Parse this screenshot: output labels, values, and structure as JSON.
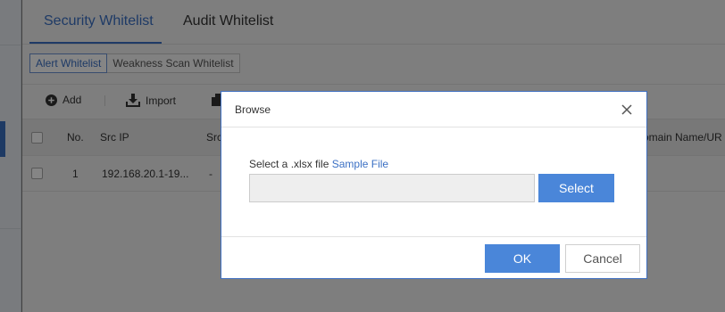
{
  "tabs": [
    {
      "label": "Security Whitelist",
      "active": true
    },
    {
      "label": "Audit Whitelist",
      "active": false
    }
  ],
  "subtabs": [
    {
      "label": "Alert Whitelist",
      "active": true
    },
    {
      "label": "Weakness Scan Whitelist",
      "active": false
    }
  ],
  "toolbar": {
    "add_label": "Add",
    "import_label": "Import"
  },
  "table": {
    "headers": [
      "No.",
      "Src IP",
      "Src",
      "omain Name/UR"
    ],
    "rows": [
      {
        "no": "1",
        "src_ip": "192.168.20.1-19...",
        "src": "-"
      }
    ]
  },
  "dialog": {
    "title": "Browse",
    "prompt": "Select a .xlsx file",
    "sample_link": "Sample File",
    "file_value": "",
    "select_label": "Select",
    "ok_label": "OK",
    "cancel_label": "Cancel"
  },
  "colors": {
    "accent": "#3b70c4",
    "primary_button": "#4a86d9"
  }
}
